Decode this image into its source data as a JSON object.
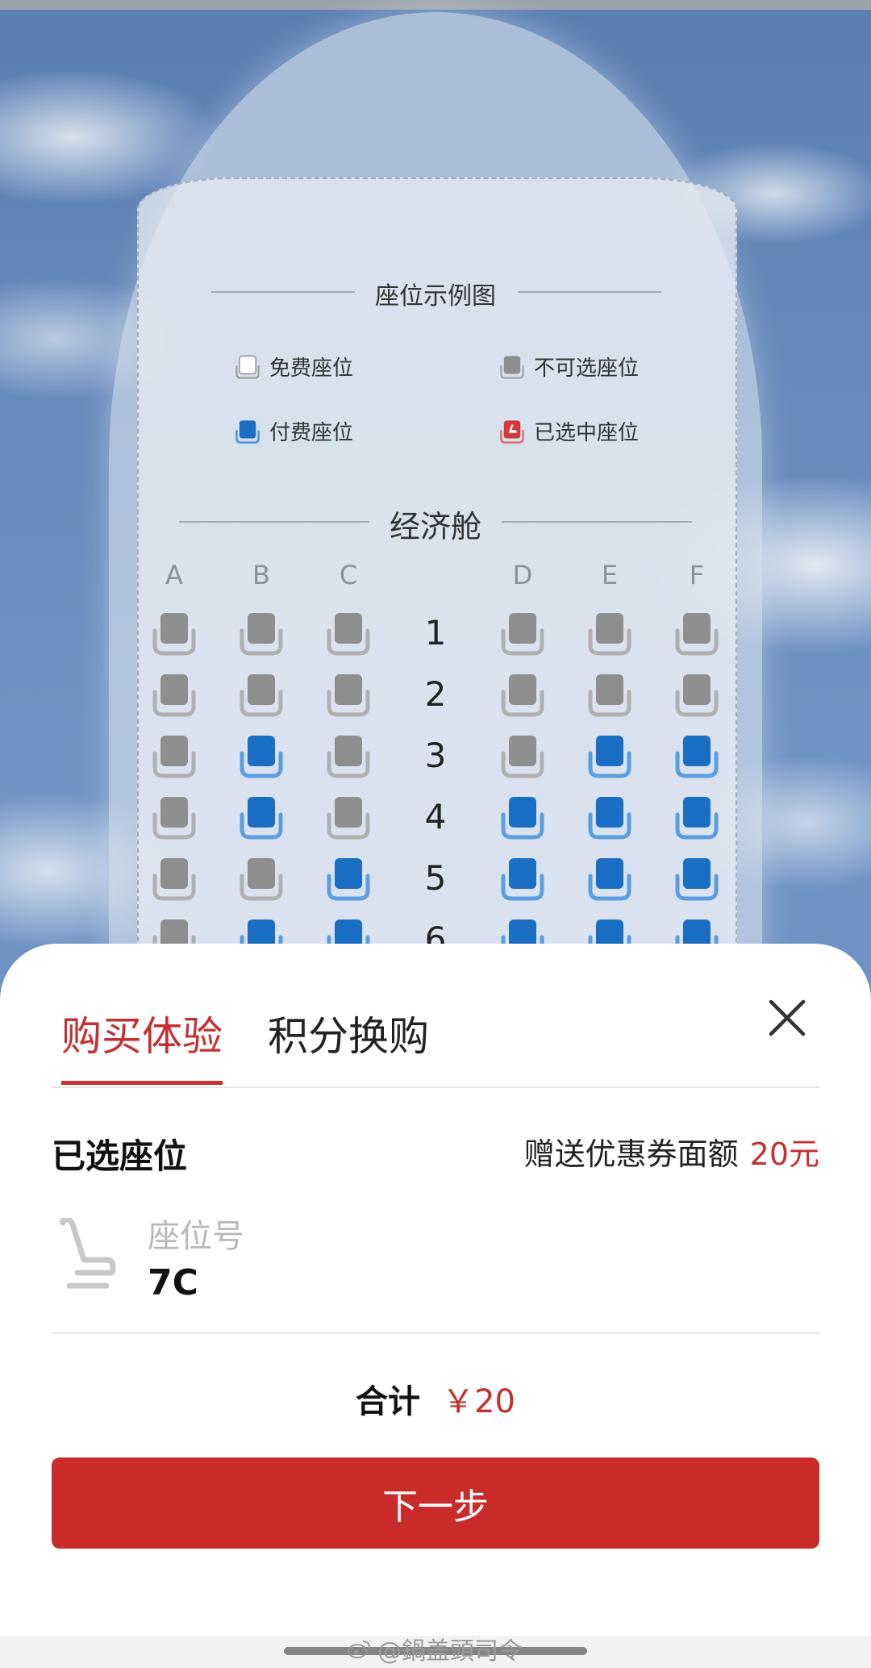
{
  "legend": {
    "title": "座位示例图",
    "items": [
      {
        "label": "免费座位",
        "icon": "seat-free-icon",
        "color": "#ffffff"
      },
      {
        "label": "不可选座位",
        "icon": "seat-unavailable-icon",
        "color": "#8e8e8e"
      },
      {
        "label": "付费座位",
        "icon": "seat-paid-icon",
        "color": "#1a6fc4"
      },
      {
        "label": "已选中座位",
        "icon": "seat-selected-icon",
        "color": "#d23a3a"
      }
    ]
  },
  "seatmap": {
    "cabin_title": "经济舱",
    "columns": [
      "A",
      "B",
      "C",
      "D",
      "E",
      "F"
    ],
    "rows": [
      {
        "number": "1",
        "seats": [
          "unavailable",
          "unavailable",
          "unavailable",
          "unavailable",
          "unavailable",
          "unavailable"
        ]
      },
      {
        "number": "2",
        "seats": [
          "unavailable",
          "unavailable",
          "unavailable",
          "unavailable",
          "unavailable",
          "unavailable"
        ]
      },
      {
        "number": "3",
        "seats": [
          "unavailable",
          "paid",
          "unavailable",
          "unavailable",
          "paid",
          "paid"
        ]
      },
      {
        "number": "4",
        "seats": [
          "unavailable",
          "paid",
          "unavailable",
          "paid",
          "paid",
          "paid"
        ]
      },
      {
        "number": "5",
        "seats": [
          "unavailable",
          "unavailable",
          "paid",
          "paid",
          "paid",
          "paid"
        ]
      },
      {
        "number": "6",
        "seats": [
          "unavailable",
          "paid",
          "paid",
          "paid",
          "paid",
          "paid"
        ]
      }
    ]
  },
  "sheet": {
    "tabs": [
      {
        "label": "购买体验",
        "active": true
      },
      {
        "label": "积分换购",
        "active": false
      }
    ],
    "close_icon": "close-icon",
    "selected_title": "已选座位",
    "coupon_label": "赠送优惠券面额",
    "coupon_amount": "20元",
    "seat_no_label": "座位号",
    "seat_no_value": "7C",
    "total_label": "合计",
    "total_value": "￥20",
    "next_button": "下一步"
  },
  "watermark": "@鍋盖頭司令",
  "colors": {
    "accent": "#c92b2b",
    "seat_paid": "#1a6fc4",
    "seat_unavailable": "#8e8e8e"
  }
}
